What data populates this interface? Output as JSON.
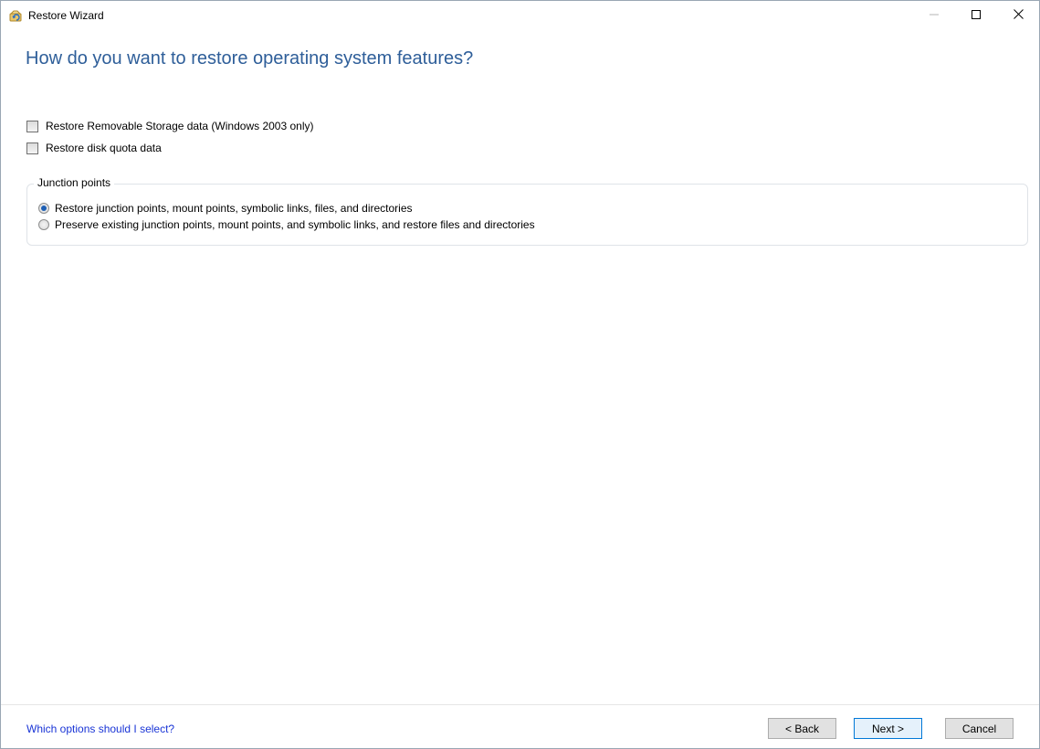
{
  "window": {
    "title": "Restore Wizard",
    "controls": {
      "minimize": "—",
      "maximize": "☐",
      "close": "✕"
    }
  },
  "page": {
    "heading": "How do you want to restore operating system features?"
  },
  "options": {
    "removable_storage": {
      "label": "Restore Removable Storage data (Windows 2003 only)",
      "checked": false
    },
    "disk_quota": {
      "label": "Restore disk quota data",
      "checked": false
    }
  },
  "junction_points": {
    "legend": "Junction points",
    "options": [
      {
        "label": "Restore junction points, mount points, symbolic links, files, and directories",
        "selected": true
      },
      {
        "label": "Preserve existing junction points, mount points, and symbolic links, and restore files and directories",
        "selected": false
      }
    ]
  },
  "footer": {
    "help_link": "Which options should I select?",
    "back_label": "< Back",
    "next_label": "Next >",
    "cancel_label": "Cancel"
  },
  "colors": {
    "heading": "#2e5e99",
    "link": "#1a35d6",
    "default_button_border": "#0078d7"
  },
  "icons": {
    "app": "restore-wizard-icon",
    "minimize": "minimize-icon",
    "maximize": "maximize-icon",
    "close": "close-icon"
  }
}
